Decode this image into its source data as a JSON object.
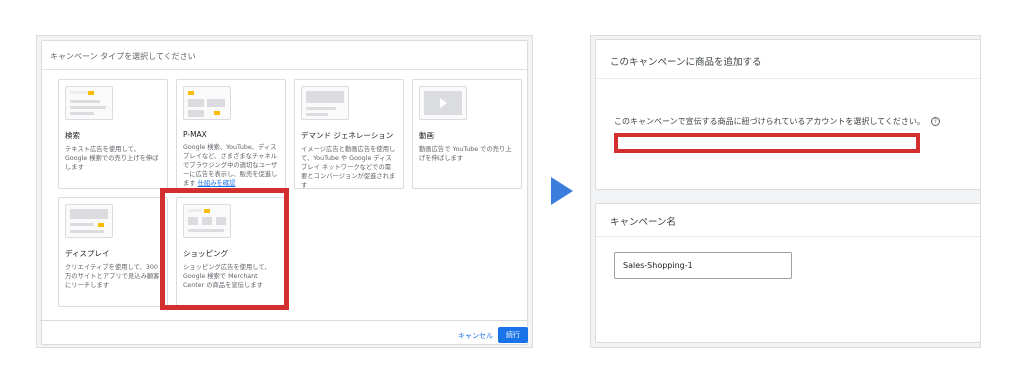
{
  "left": {
    "title": "キャンペーン タイプを選択してください",
    "cards": [
      {
        "name": "検索",
        "desc": "テキスト広告を使用して、Google 検索での売り上げを伸ばします",
        "link": ""
      },
      {
        "name": "P-MAX",
        "desc": "Google 検索、YouTube、ディスプレイなど、さまざまなチャネルでブラウジング中の適切なユーザーに広告を表示し、販売を促進します",
        "link": "仕組みを確認"
      },
      {
        "name": "デマンド ジェネレーション",
        "desc": "イメージ広告と動画広告を使用して、YouTube や Google ディスプレイ ネットワークなどでの需要とコンバージョンが促進されます",
        "link": ""
      },
      {
        "name": "動画",
        "desc": "動画広告で YouTube での売り上げを伸ばします",
        "link": ""
      },
      {
        "name": "ディスプレイ",
        "desc": "クリエイティブを使用して、300 万のサイトとアプリで見込み顧客にリーチします",
        "link": ""
      },
      {
        "name": "ショッピング",
        "desc": "ショッピング広告を使用して、Google 検索で Merchant Center の商品を宣伝します",
        "link": ""
      }
    ],
    "cancel_label": "キャンセル",
    "next_label": "続行"
  },
  "right": {
    "section1_title": "このキャンペーンに商品を追加する",
    "instruction": "このキャンペーンで宣伝する商品に紐づけられているアカウントを選択してください。",
    "help_glyph": "?",
    "section2_title": "キャンペーン名",
    "campaign_name": "Sales-Shopping-1"
  },
  "colors": {
    "highlight": "#d32f2f",
    "accent": "#1a73e8",
    "arrow": "#3b7ddd"
  }
}
